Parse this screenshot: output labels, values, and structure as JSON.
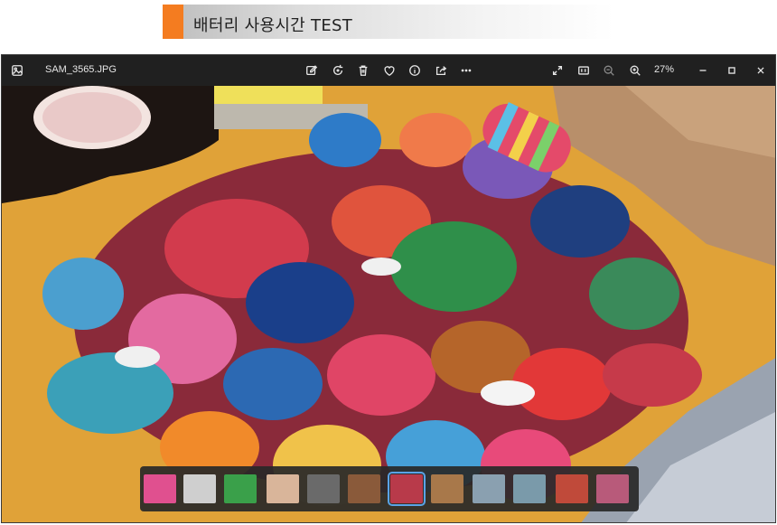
{
  "banner": {
    "title": "배터리 사용시간 TEST",
    "accent_color": "#f47c20"
  },
  "viewer": {
    "file_name": "SAM_3565.JPG",
    "zoom_level": "27%",
    "toolbar": [
      {
        "id": "edit",
        "icon": "edit-image-icon"
      },
      {
        "id": "rotate",
        "icon": "rotate-icon"
      },
      {
        "id": "delete",
        "icon": "trash-icon"
      },
      {
        "id": "favorite",
        "icon": "heart-icon"
      },
      {
        "id": "info",
        "icon": "info-icon"
      },
      {
        "id": "share",
        "icon": "share-icon"
      },
      {
        "id": "more",
        "icon": "more-icon"
      }
    ],
    "right_controls": [
      {
        "id": "fullscreen",
        "icon": "fullscreen-icon"
      },
      {
        "id": "actual-size",
        "icon": "actual-size-icon"
      },
      {
        "id": "zoom-out",
        "icon": "zoom-out-icon"
      },
      {
        "id": "zoom-in",
        "icon": "zoom-in-icon"
      }
    ],
    "window_controls": [
      "minimize-icon",
      "maximize-icon",
      "close-icon"
    ],
    "filmstrip": {
      "count": 12,
      "selected_index": 6
    }
  },
  "colors": {
    "app_bg": "#202020",
    "selection": "#5aa3e6"
  }
}
